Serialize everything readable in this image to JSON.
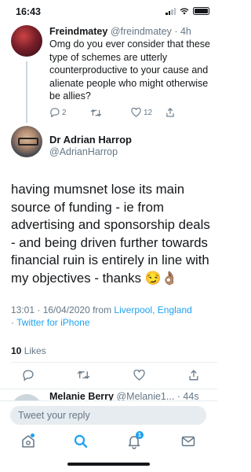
{
  "status_bar": {
    "time": "16:43"
  },
  "reply_tweet": {
    "name": "Freindmatey",
    "handle": "@freindmatey",
    "age": "· 4h",
    "text": "Omg do you ever consider that these type of schemes are utterly counterproductive to your cause and alienate people who might otherwise be allies?",
    "reply_count": "2",
    "like_count": "12"
  },
  "main_tweet": {
    "name": "Dr Adrian Harrop",
    "handle": "@AdrianHarrop",
    "text": "having mumsnet lose its main source of funding - ie from advertising and sponsorship deals - and being driven further towards financial ruin is entirely in line with my objectives - thanks 😏👌🏽",
    "timestamp": "13:01 · 16/04/2020 from ",
    "location": "Liverpool, England",
    "client_prefix": "· ",
    "client": "Twitter for iPhone",
    "likes_count": "10",
    "likes_label": " Likes"
  },
  "next_tweet": {
    "name": "Melanie Berry",
    "handle": "@Melanie1...",
    "age": "· 44s"
  },
  "composer": {
    "placeholder": "Tweet your reply"
  },
  "tab_bar": {
    "notifications_badge": "1"
  },
  "colors": {
    "accent": "#1da1f2",
    "muted": "#657786",
    "text": "#14171a",
    "separator": "#e6ecf0"
  }
}
